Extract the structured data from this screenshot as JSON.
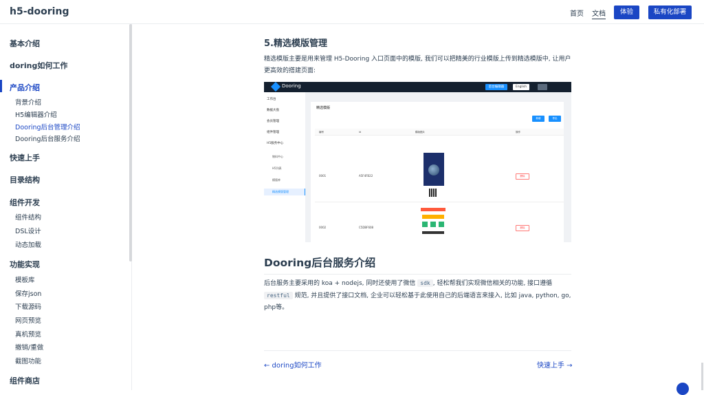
{
  "navbar": {
    "site_name": "h5-dooring",
    "links": [
      "首页",
      "文档"
    ],
    "buttons": [
      "体验",
      "私有化部署"
    ]
  },
  "sidebar": {
    "groups": [
      {
        "label": "基本介绍"
      },
      {
        "label": "doring如何工作"
      },
      {
        "label": "产品介绍",
        "items": [
          "背景介绍",
          "H5编辑器介绍",
          "Dooring后台管理介绍",
          "Dooring后台服务介绍"
        ]
      },
      {
        "label": "快速上手"
      },
      {
        "label": "目录结构"
      },
      {
        "label": "组件开发",
        "items": [
          "组件结构",
          "DSL设计",
          "动态加载"
        ]
      },
      {
        "label": "功能实现",
        "items": [
          "模板库",
          "保存json",
          "下载源码",
          "网页预览",
          "真机预览",
          "撤销/重做",
          "截图功能"
        ]
      },
      {
        "label": "组件商店"
      }
    ]
  },
  "main": {
    "section_title": "5.精选模版管理",
    "section_para": "精选模版主要是用来管理 H5-Dooring 入口页面中的模版, 我们可以把精美的行业模版上传到精选模版中, 让用户更高效的搭建页面:",
    "screenshot": {
      "brand": "Dooring",
      "top_buttons": [
        "后台编辑器",
        "English"
      ],
      "menu": [
        "工作台",
        "数据大盘",
        "会员管理",
        "组件管理",
        "H5服务中心"
      ],
      "submenu": [
        "物料中心",
        "H5列表",
        "模版库",
        "精选模版管理"
      ],
      "page_title": "精选模版",
      "actions": [
        "新增",
        "导出"
      ],
      "columns": [
        "编号",
        "Id",
        "模版图片",
        "操作"
      ],
      "rows": [
        {
          "num": "0001",
          "id": "A5F4FB22",
          "op": "删除"
        },
        {
          "num": "0002",
          "id": "C5DBF608",
          "op": "删除"
        }
      ]
    },
    "service_title": "Dooring后台服务介绍",
    "service_para": {
      "p1": "后台服务主要采用的 koa + nodejs, 同时还使用了微信 ",
      "code1": "sdk",
      "p2": ", 轻松帮我们实现微信相关的功能, 接口遵循 ",
      "code2": "restful",
      "p3": " 规范, 并且提供了接口文档, 企业可以轻松基于此使用自己的后端语言来接入, 比如 java, python, go, php等。"
    },
    "prev_link": "← doring如何工作",
    "next_link": "快速上手 →"
  }
}
